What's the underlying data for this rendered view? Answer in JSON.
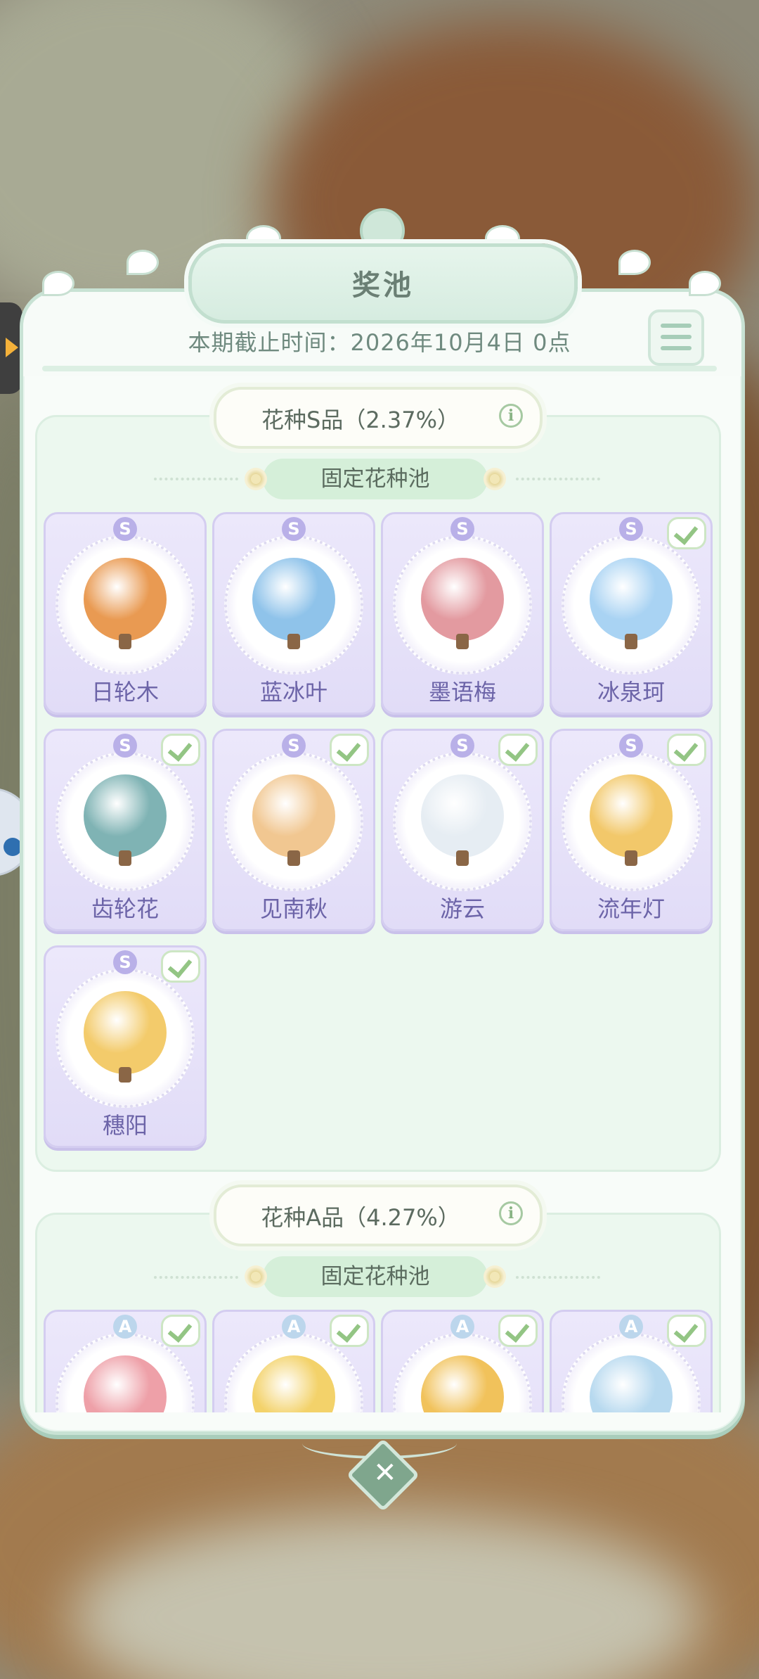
{
  "title": "奖池",
  "deadline": "本期截止时间：2026年10月4日 0点",
  "sections": [
    {
      "header": "花种S品（2.37%）",
      "pool_label": "固定花种池",
      "items": [
        {
          "grade": "S",
          "name": "日轮木",
          "owned": false,
          "color": "#e99a52"
        },
        {
          "grade": "S",
          "name": "蓝冰叶",
          "owned": false,
          "color": "#8fc3ea"
        },
        {
          "grade": "S",
          "name": "墨语梅",
          "owned": false,
          "color": "#e39aa0"
        },
        {
          "grade": "S",
          "name": "冰泉珂",
          "owned": true,
          "color": "#a9d3f3"
        },
        {
          "grade": "S",
          "name": "齿轮花",
          "owned": true,
          "color": "#7fb3b4"
        },
        {
          "grade": "S",
          "name": "见南秋",
          "owned": true,
          "color": "#f1c791"
        },
        {
          "grade": "S",
          "name": "游云",
          "owned": true,
          "color": "#e6edf3"
        },
        {
          "grade": "S",
          "name": "流年灯",
          "owned": true,
          "color": "#f2c86a"
        },
        {
          "grade": "S",
          "name": "穗阳",
          "owned": true,
          "color": "#f3cb6b"
        }
      ]
    },
    {
      "header": "花种A品（4.27%）",
      "pool_label": "固定花种池",
      "items": [
        {
          "grade": "A",
          "name": "",
          "owned": true,
          "color": "#eea0a8"
        },
        {
          "grade": "A",
          "name": "",
          "owned": true,
          "color": "#f3d26a"
        },
        {
          "grade": "A",
          "name": "",
          "owned": true,
          "color": "#f1c25b"
        },
        {
          "grade": "A",
          "name": "",
          "owned": true,
          "color": "#b7d9ef"
        }
      ]
    }
  ],
  "close_label": "✕"
}
